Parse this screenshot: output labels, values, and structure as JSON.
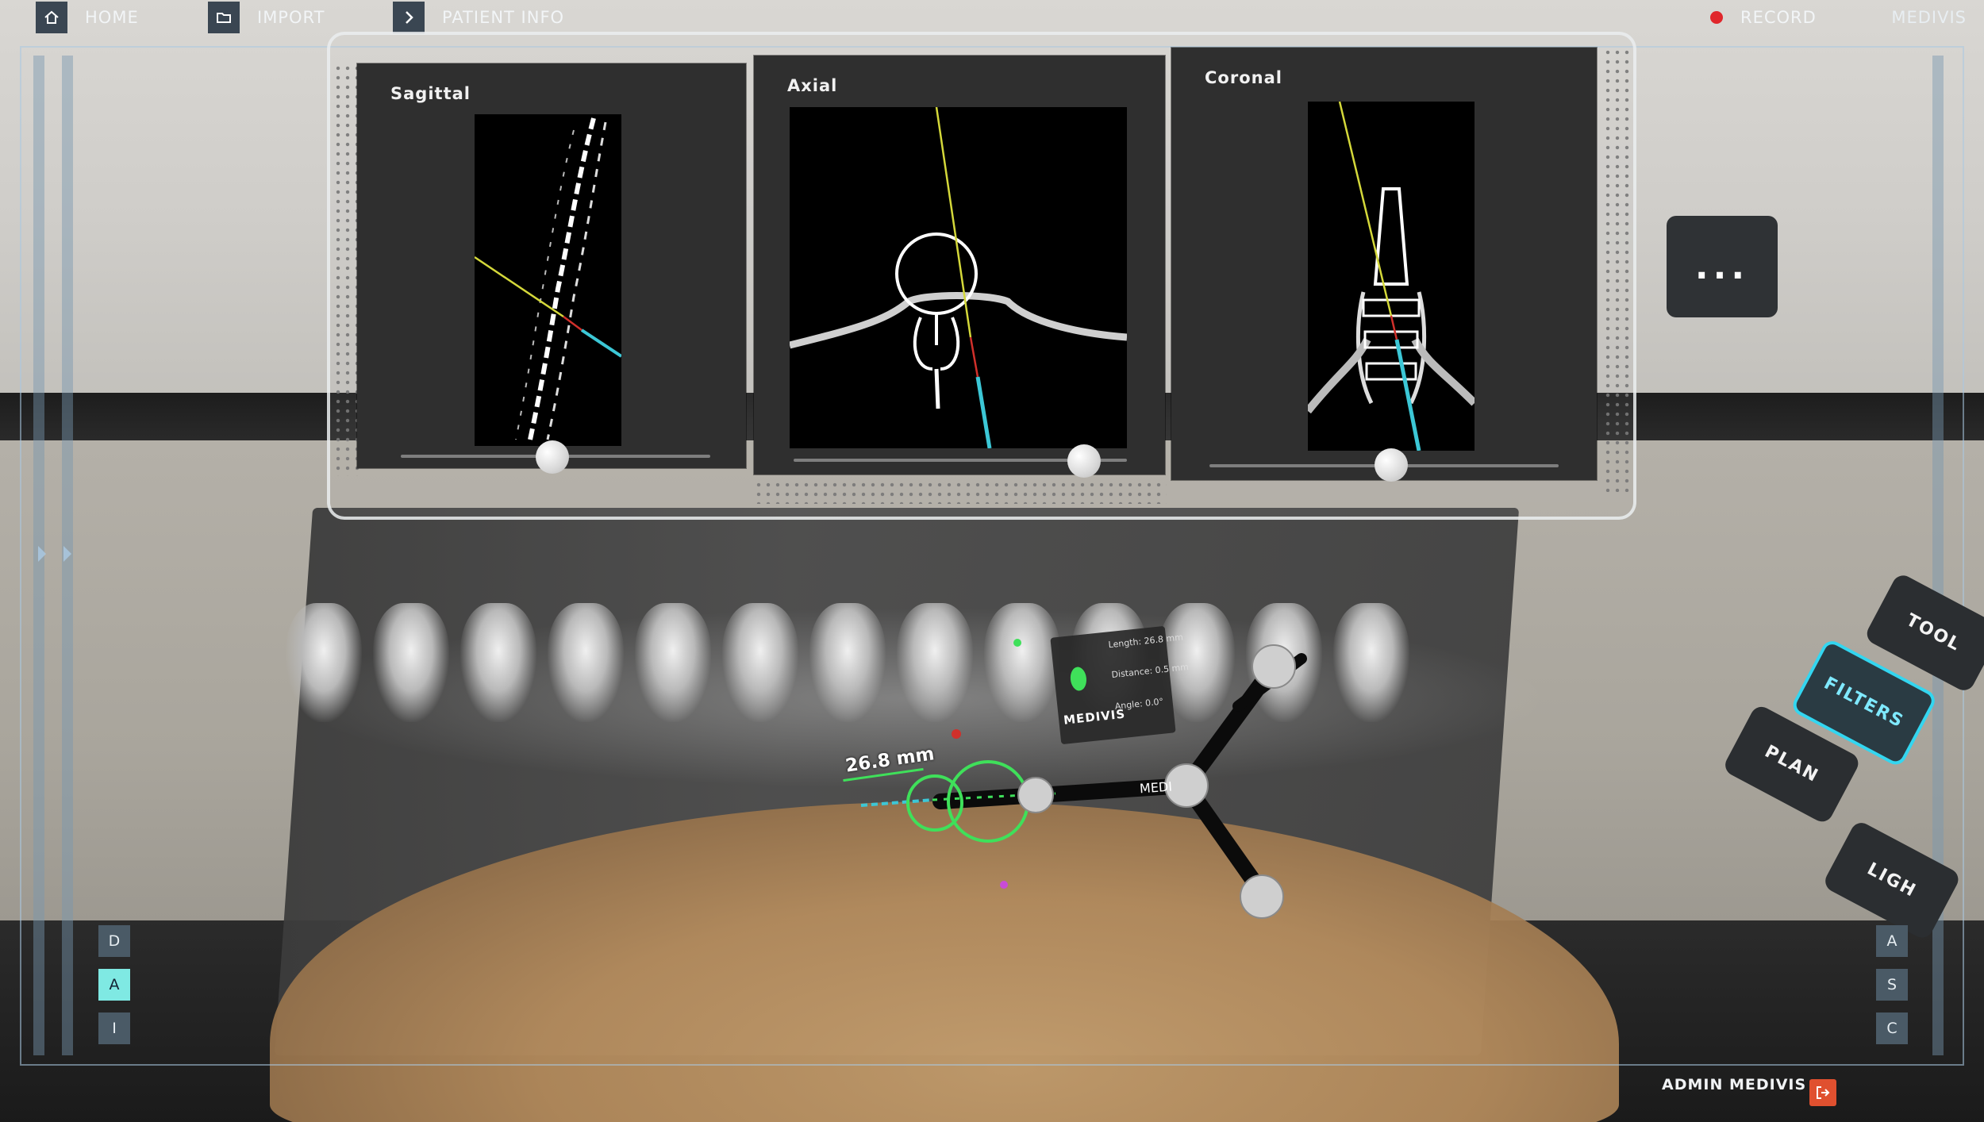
{
  "nav": {
    "home_label": "HOME",
    "import_label": "IMPORT",
    "patient_info_label": "PATIENT INFO",
    "record_label": "RECORD",
    "brand": "MEDIVIS"
  },
  "views": [
    {
      "title": "Sagittal",
      "slider_position": 0.5
    },
    {
      "title": "Axial",
      "slider_position": 0.86
    },
    {
      "title": "Coronal",
      "slider_position": 0.52
    }
  ],
  "more_button_label": "...",
  "tool_menu": {
    "items": [
      "TOOL",
      "FILTERS",
      "PLAN",
      "LIGH"
    ],
    "active": "FILTERS"
  },
  "left_orientation_buttons": [
    "D",
    "A",
    "I"
  ],
  "left_active": "A",
  "right_orientation_buttons": [
    "A",
    "S",
    "C"
  ],
  "measurement": {
    "value": "26.8 mm"
  },
  "info_card": {
    "brand": "MEDIVIS",
    "length_label": "Length:",
    "length_value": "26.8 mm",
    "distance_label": "Distance:",
    "distance_value": "0.5 mm",
    "angle_label": "Angle:",
    "angle_value": "0.0°"
  },
  "instrument_brand": "MEDI",
  "user": {
    "name": "ADMIN MEDIVIS"
  },
  "colors": {
    "accent_cyan": "#33d6f0",
    "record_red": "#e0262b",
    "guide_green": "#3fe05a",
    "trajectory_yellow": "#d4d83a",
    "trajectory_cyan": "#3cc7d6",
    "logout_orange": "#e0502f"
  },
  "icons": {
    "home": "home-icon",
    "import": "folder-icon",
    "patient_info": "chevron-right-icon",
    "record": "record-dot-icon",
    "logout": "logout-icon"
  }
}
